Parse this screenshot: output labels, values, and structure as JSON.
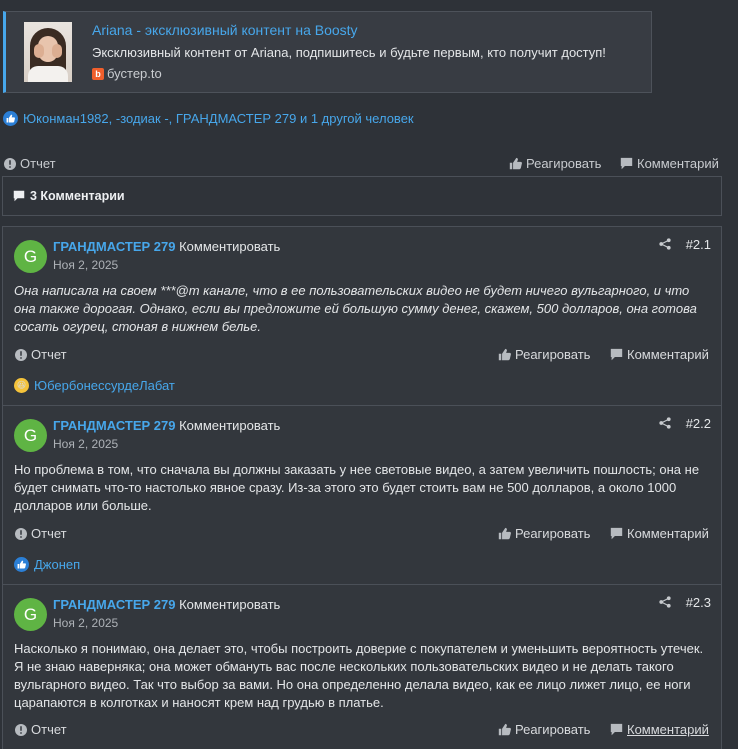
{
  "embed": {
    "title": "Ariana - эксклюзивный контент на Boosty",
    "description": "Эксклюзивный контент от Ariana, подпишитесь и будьте первым, кто получит доступ!",
    "source": "бустер.to",
    "source_icon_letter": "b"
  },
  "post_reactions": {
    "users": "Юконман1982, -зодиак -, ГРАНДМАСТЕР 279 и 1 другой человек"
  },
  "post_actions": {
    "report": "Отчет",
    "react": "Реагировать",
    "comment": "Комментарий"
  },
  "comments_header": "3 Комментарии",
  "comments": [
    {
      "avatar_letter": "G",
      "author": "ГРАНДМАСТЕР 279",
      "verb": "Комментировать",
      "date": "Ноя 2, 2025",
      "number": "#2.1",
      "body": "Она написала на своем ***@m канале, что в ее пользовательских видео не будет ничего вульгарного, и что она также дорогая. Однако, если вы предложите ей большую сумму денег, скажем, 500 долларов, она готова сосать огурец, стоная в нижнем белье.",
      "report": "Отчет",
      "react": "Реагировать",
      "comment": "Комментарий",
      "reaction_user": "ЮбербонессурдеЛабат"
    },
    {
      "avatar_letter": "G",
      "author": "ГРАНДМАСТЕР 279",
      "verb": "Комментировать",
      "date": "Ноя 2, 2025",
      "number": "#2.2",
      "body": "Но проблема в том, что сначала вы должны заказать у нее световые видео, а затем увеличить пошлость; она не будет снимать что-то настолько явное сразу. Из-за этого это будет стоить вам не 500 долларов, а около 1000 долларов или больше.",
      "report": "Отчет",
      "react": "Реагировать",
      "comment": "Комментарий",
      "reaction_user": "Джонеп"
    },
    {
      "avatar_letter": "G",
      "author": "ГРАНДМАСТЕР 279",
      "verb": "Комментировать",
      "date": "Ноя 2, 2025",
      "number": "#2.3",
      "body": "Насколько я понимаю, она делает это, чтобы построить доверие с покупателем и уменьшить вероятность утечек. Я не знаю наверняка; она может обмануть вас после нескольких пользовательских видео и не делать такого вульгарного видео. Так что выбор за вами. Но она определенно делала видео, как ее лицо лижет лицо, ее ноги царапаются в колготках и наносят крем над грудью в платье.",
      "report": "Отчет",
      "react": "Реагировать",
      "comment": "Комментарий"
    }
  ]
}
